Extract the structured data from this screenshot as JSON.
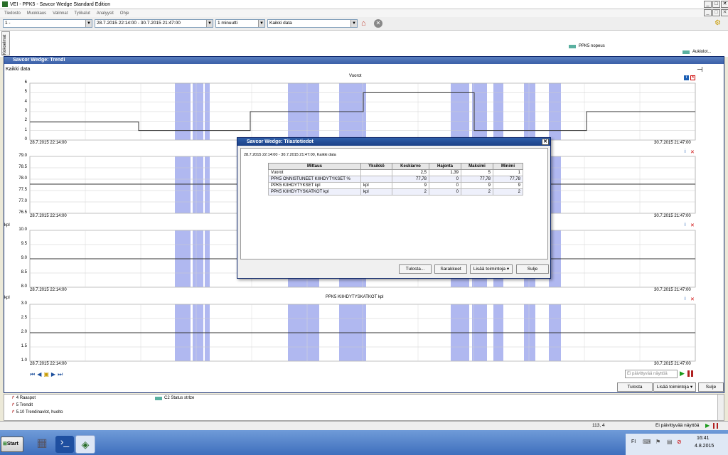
{
  "window": {
    "title": "VEI - PPK5 - Savcor Wedge Standard Edition"
  },
  "menu": [
    "Tiedosto",
    "Muokkaus",
    "Valinnat",
    "Työkalut",
    "Analyysit",
    "Ohje"
  ],
  "toolbar": {
    "selector_value": "1 -",
    "date_range": "28.7.2015 22:14:00  -  30.7.2015 21:47:00",
    "interval": "1 minuutti",
    "data_scope": "Kaikki data"
  },
  "sidebar_tab_label": "Kokoelmat",
  "bg_legend": {
    "item1": "PPK5 nopeus",
    "item2": "Aukiolot..."
  },
  "trend_window": {
    "title": "Savcor Wedge: Trendi",
    "scope_label": "Kaikki data",
    "date_start": "28.7.2015 22:14:00",
    "date_end": "30.7.2015 21:47:00",
    "buttons": {
      "tulosta": "Tulosta",
      "lisaa": "Lisää toimintoja",
      "sulje": "Sulje"
    },
    "refresh_placeholder": "Ei päivittyvää näyttöä"
  },
  "charts": [
    {
      "title": "Vuorot",
      "unit": "",
      "ticks": [
        "6",
        "5",
        "4",
        "3",
        "2",
        "1",
        "0"
      ]
    },
    {
      "title": "",
      "unit": "",
      "ticks": [
        "79.0",
        "78.5",
        "78.0",
        "77.5",
        "77.0",
        "76.5"
      ]
    },
    {
      "title": "",
      "unit": "kpl",
      "ticks": [
        "10.0",
        "9.5",
        "9.0",
        "8.5",
        "8.0"
      ]
    },
    {
      "title": "PPK5 KIIHDYTYSKATKOT kpl",
      "unit": "kpl",
      "ticks": [
        "3.0",
        "2.5",
        "2.0",
        "1.5",
        "1.0"
      ]
    }
  ],
  "dialog": {
    "title": "Savcor Wedge: Tilastotiedot",
    "subtitle": "28.7.2015 22:14:00 - 30.7.2015 21:47:00, Kaikki data",
    "headers": [
      "Mittaus",
      "Yksikkö",
      "Keskiarvo",
      "Hajonta",
      "Maksimi",
      "Minimi"
    ],
    "rows": [
      [
        "Vuorot",
        "",
        "2,5",
        "1,39",
        "5",
        "1"
      ],
      [
        "PPK5 ONNISTUNEET KIIHDYTYKSET %",
        "",
        "77,78",
        "0",
        "77,78",
        "77,78"
      ],
      [
        "PPK5 KIIHDYTYKSET kpl",
        "kpl",
        "9",
        "0",
        "9",
        "9"
      ],
      [
        "PPK5 KIIHDYTYSKATKOT kpl",
        "kpl",
        "2",
        "0",
        "2",
        "2"
      ]
    ],
    "buttons": {
      "tulosta": "Tulosta...",
      "sarakkeet": "Sarakkeet",
      "lisaa": "Lisää toimintoja",
      "sulje": "Sulje"
    }
  },
  "bottom_panel": {
    "items": [
      "4 Raaspot",
      "5 Trendit",
      "5.10 Trendinavlot, huolto"
    ],
    "legend": "C2 Status strlze"
  },
  "status": {
    "coords": "113, 4",
    "refresh": "Ei päivittyvää näyttöä"
  },
  "taskbar": {
    "start": "Start",
    "lang": "FI",
    "time": "16:41",
    "date": "4.8.2015"
  },
  "colors": {
    "band": "#b0b8f0",
    "title_blue": "#1c4087"
  }
}
